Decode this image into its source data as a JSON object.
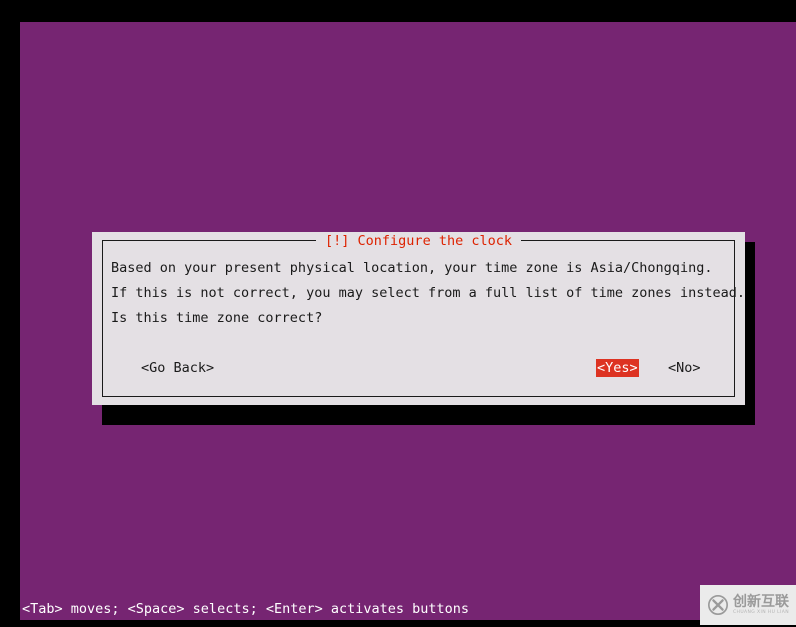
{
  "screen": {
    "background_color": "#000000",
    "desktop_color": "#762572"
  },
  "dialog": {
    "title": "[!] Configure the clock",
    "title_color": "#dd2200",
    "background_color": "#e4e0e4",
    "body_lines": [
      "Based on your present physical location, your time zone is Asia/Chongqing.",
      "If this is not correct, you may select from a full list of time zones instead.",
      "Is this time zone correct?"
    ],
    "buttons": [
      {
        "label": "<Go Back>",
        "selected": false
      },
      {
        "label": "<Yes>",
        "selected": true
      },
      {
        "label": "<No>",
        "selected": false
      }
    ],
    "selected_button_bg": "#dd3322",
    "selected_button_fg": "#ffffff"
  },
  "statusbar": {
    "text": "<Tab> moves; <Space> selects; <Enter> activates buttons"
  },
  "watermark": {
    "cn": "创新互联",
    "pinyin": "CHUANG XIN HU LIAN",
    "mark_letter": "X"
  }
}
